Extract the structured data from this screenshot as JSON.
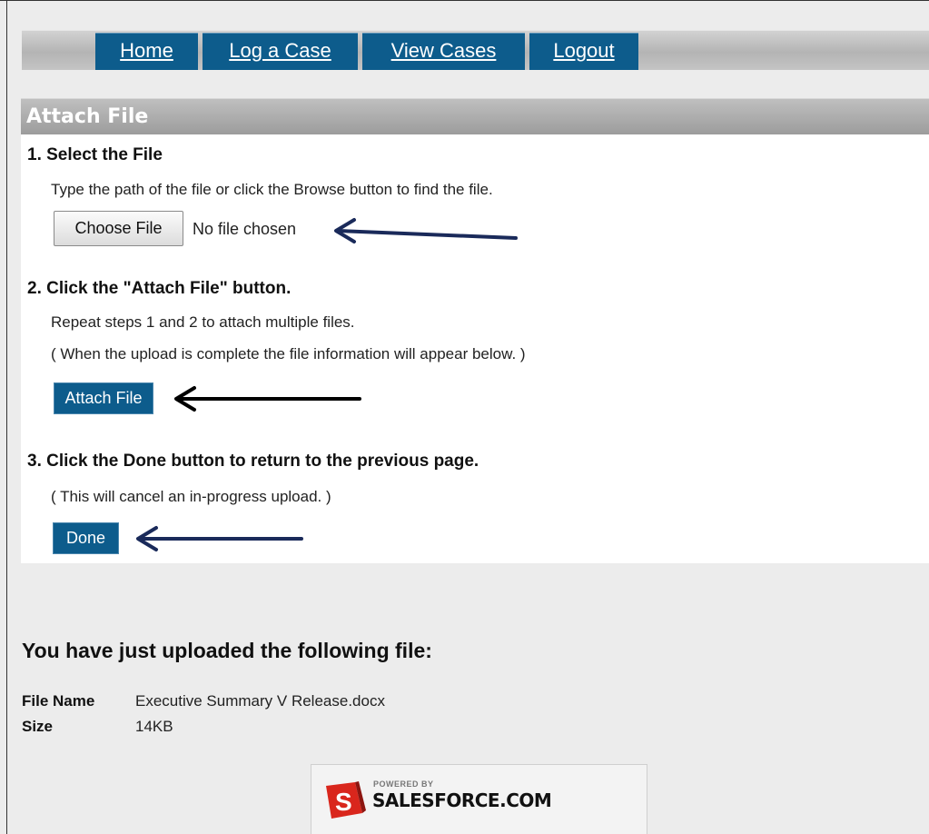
{
  "nav": {
    "tabs": [
      {
        "label": "Home"
      },
      {
        "label": "Log a Case"
      },
      {
        "label": "View Cases"
      },
      {
        "label": "Logout"
      }
    ]
  },
  "panel": {
    "title": "Attach File",
    "step1": {
      "title": "1. Select the File",
      "text": "Type the path of the file or click the Browse button to find the file.",
      "choose_label": "Choose File",
      "no_file_text": "No file chosen"
    },
    "step2": {
      "title": "2. Click the \"Attach File\" button.",
      "text1": "Repeat steps 1 and 2 to attach multiple files.",
      "text2": "( When the upload is complete the file information will appear below. )",
      "button_label": "Attach File"
    },
    "step3": {
      "title": "3. Click the Done button to return to the previous page.",
      "text": "( This will cancel an in-progress upload. )",
      "button_label": "Done"
    }
  },
  "uploaded": {
    "title": "You have just uploaded the following file:",
    "file_name_label": "File Name",
    "file_name_value": "Executive Summary V Release.docx",
    "size_label": "Size",
    "size_value": "14KB"
  },
  "footer": {
    "powered_by": "POWERED BY",
    "brand": "SALESFORCE.COM",
    "logo_letter": "S"
  },
  "colors": {
    "tab_blue": "#0d5c8c",
    "arrow_navy": "#1a2a5a",
    "arrow_black": "#000000",
    "logo_red": "#d9261c"
  }
}
